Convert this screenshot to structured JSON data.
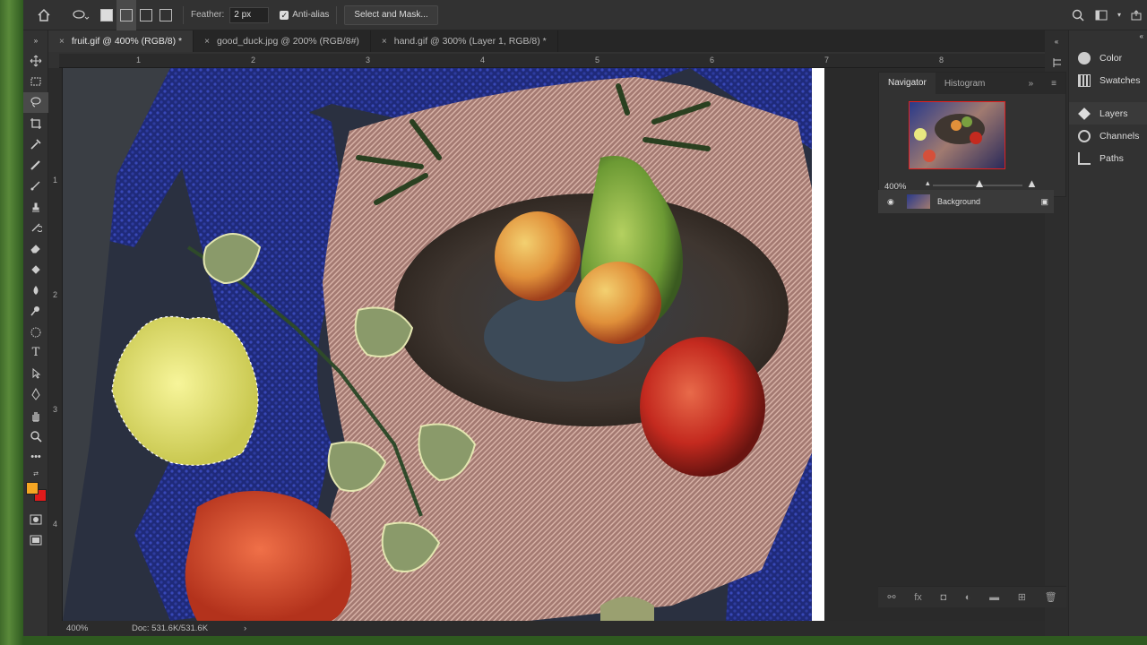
{
  "options": {
    "feather_label": "Feather:",
    "feather_value": "2 px",
    "antialias_label": "Anti-alias",
    "select_mask_label": "Select and Mask..."
  },
  "tabs": [
    {
      "label": "fruit.gif @ 400% (RGB/8) *",
      "active": true
    },
    {
      "label": "good_duck.jpg @ 200% (RGB/8#)",
      "active": false
    },
    {
      "label": "hand.gif @ 300% (Layer 1, RGB/8) *",
      "active": false
    }
  ],
  "ruler": {
    "h": [
      "1",
      "2",
      "3",
      "4",
      "5",
      "6",
      "7",
      "8"
    ],
    "v": [
      "1",
      "2",
      "3",
      "4"
    ]
  },
  "status": {
    "zoom": "400%",
    "doc": "Doc: 531.6K/531.6K"
  },
  "navigator": {
    "tab1": "Navigator",
    "tab2": "Histogram",
    "zoom": "400%"
  },
  "layers": {
    "name": "Background"
  },
  "panels": {
    "color": "Color",
    "swatches": "Swatches",
    "layers": "Layers",
    "channels": "Channels",
    "paths": "Paths"
  },
  "colors": {
    "foreground": "#f5a623",
    "background": "#e01b1b"
  }
}
